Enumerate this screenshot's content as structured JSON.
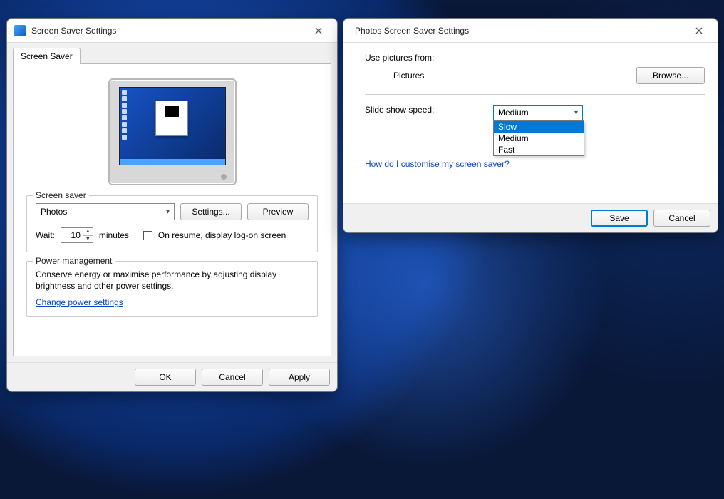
{
  "dlg1": {
    "title": "Screen Saver Settings",
    "tab_label": "Screen Saver",
    "group_saver": {
      "legend": "Screen saver",
      "saver_select_value": "Photos",
      "settings_btn": "Settings...",
      "preview_btn": "Preview",
      "wait_label": "Wait:",
      "wait_value": "10",
      "wait_unit": "minutes",
      "resume_checkbox_label": "On resume, display log-on screen",
      "resume_checked": false
    },
    "group_power": {
      "legend": "Power management",
      "text": "Conserve energy or maximise performance by adjusting display brightness and other power settings.",
      "link": "Change power settings"
    },
    "buttons": {
      "ok": "OK",
      "cancel": "Cancel",
      "apply": "Apply"
    }
  },
  "dlg2": {
    "title": "Photos Screen Saver Settings",
    "use_pictures_label": "Use pictures from:",
    "folder_value": "Pictures",
    "browse_btn": "Browse...",
    "speed_label": "Slide show speed:",
    "speed_value": "Medium",
    "speed_options": [
      "Slow",
      "Medium",
      "Fast"
    ],
    "speed_highlighted": "Slow",
    "help_link": "How do I customise my screen saver?",
    "buttons": {
      "save": "Save",
      "cancel": "Cancel"
    }
  }
}
